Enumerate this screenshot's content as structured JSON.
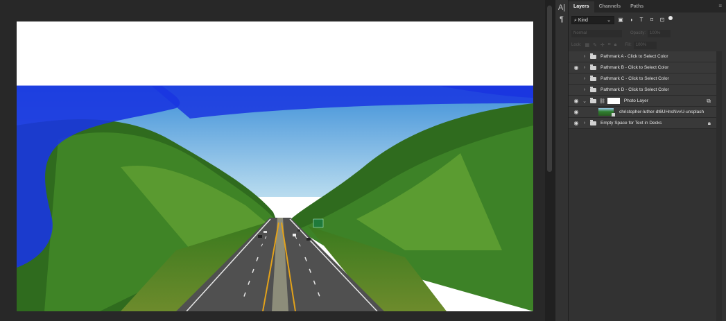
{
  "panel": {
    "tabs": [
      "Layers",
      "Channels",
      "Paths"
    ],
    "active_tab": "Layers"
  },
  "filter": {
    "kind_label": "Kind",
    "kind_caret": "⌄"
  },
  "blend": {
    "mode": "Normal",
    "opacity_label": "Opacity:",
    "opacity_value": "100%"
  },
  "lock": {
    "label": "Lock:",
    "fill_label": "Fill:",
    "fill_value": "100%"
  },
  "layers": [
    {
      "name": "Pathmark A - Click to Select Color",
      "visible": false,
      "type": "group"
    },
    {
      "name": "Pathmark B - Click to Select Color",
      "visible": true,
      "type": "group"
    },
    {
      "name": "Pathmark C - Click to Select Color",
      "visible": false,
      "type": "group"
    },
    {
      "name": "Pathmark D - Click to Select Color",
      "visible": false,
      "type": "group"
    },
    {
      "name": "Photo Layer",
      "visible": true,
      "type": "group-expanded-masked"
    },
    {
      "name": "christopher-luther-dt6UHnsNvvU-unsplash",
      "visible": true,
      "type": "smart-object"
    },
    {
      "name": "Empty Space for Text in Decks",
      "visible": true,
      "type": "group-locked"
    }
  ],
  "colors": {
    "blue_overlay": "#1a36e0",
    "canvas_bg": "#282828",
    "panel_bg": "#323232"
  }
}
